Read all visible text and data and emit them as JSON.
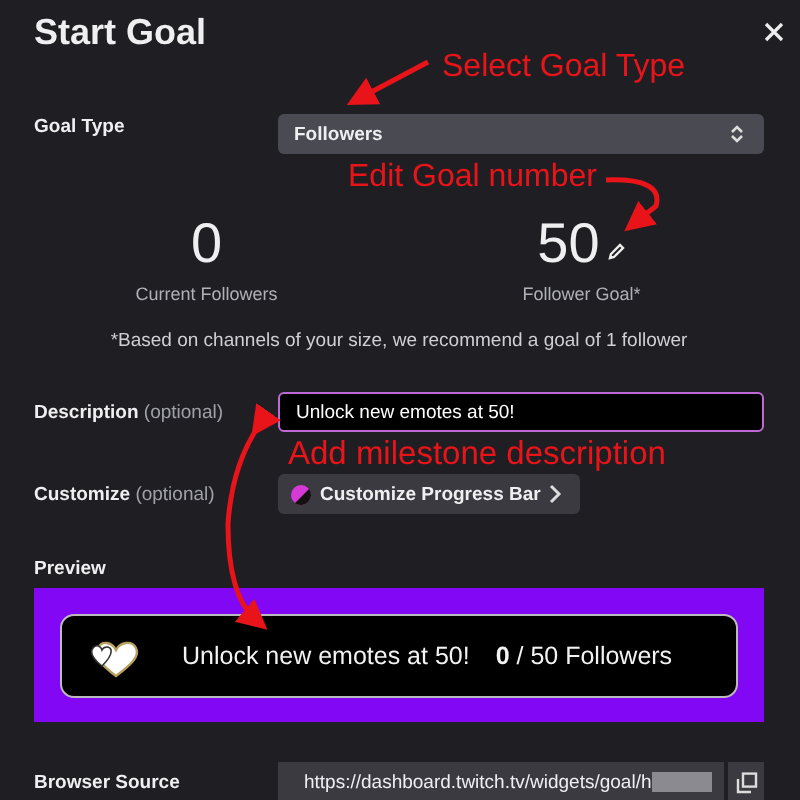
{
  "dialog": {
    "title": "Start Goal"
  },
  "goal_type": {
    "label": "Goal Type",
    "value": "Followers"
  },
  "stats": [
    {
      "value": "0",
      "label": "Current Followers",
      "editable": false
    },
    {
      "value": "50",
      "label": "Follower Goal*",
      "editable": true
    }
  ],
  "recommendation": "*Based on channels of your size, we recommend a goal of 1 follower",
  "description": {
    "label": "Description",
    "hint": "(optional)",
    "value": "Unlock new emotes at 50!",
    "focused": true
  },
  "customize": {
    "label": "Customize",
    "hint": "(optional)",
    "button": "Customize Progress Bar"
  },
  "preview": {
    "label": "Preview",
    "text": "Unlock new emotes at 50!",
    "current": "0",
    "goal_text": "/ 50 Followers"
  },
  "browser_source": {
    "label": "Browser Source",
    "url": "https://dashboard.twitch.tv/widgets/goal/h"
  },
  "annotations": [
    {
      "text": "Select Goal Type"
    },
    {
      "text": "Edit Goal number"
    },
    {
      "text": "Add milestone description"
    }
  ]
}
